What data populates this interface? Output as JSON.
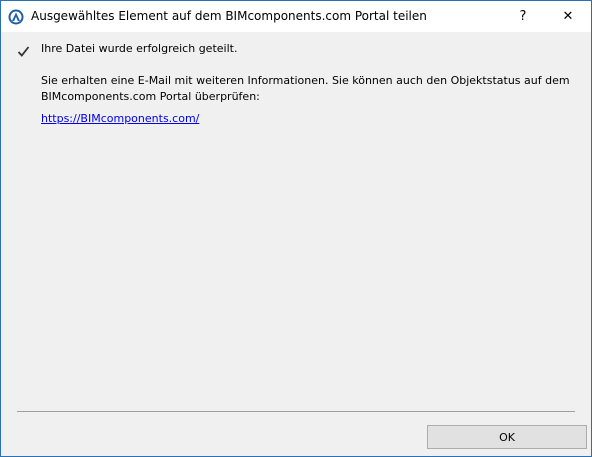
{
  "dialog": {
    "title": "Ausgewähltes Element auf dem BIMcomponents.com Portal teilen",
    "help_label": "?",
    "close_label": "✕",
    "app_icon": "archicad-icon"
  },
  "message": {
    "status_icon": "checkmark-icon",
    "status": "Ihre Datei wurde erfolgreich geteilt.",
    "info": "Sie erhalten eine E-Mail mit weiteren Informationen. Sie können auch den Objektstatus auf dem BIMcomponents.com Portal überprüfen:",
    "link": "https://BIMcomponents.com/"
  },
  "footer": {
    "ok_label": "OK"
  },
  "colors": {
    "window_border": "#2b6fb5",
    "link": "#0000ee",
    "background": "#f0f0f0",
    "button_face": "#e1e1e1"
  }
}
